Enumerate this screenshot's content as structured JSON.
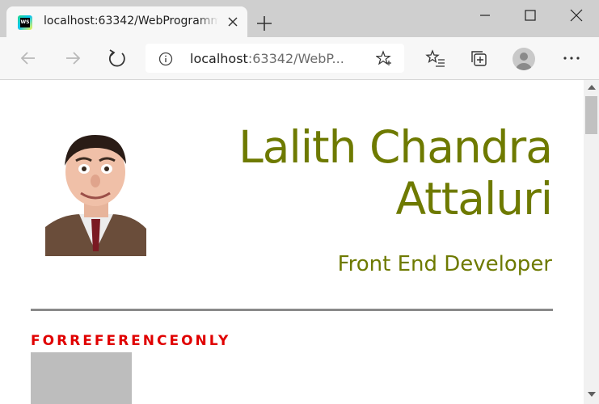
{
  "browser": {
    "tab": {
      "favicon": "webstorm-icon",
      "title": "localhost:63342/WebProgramming"
    },
    "address": {
      "host": "localhost",
      "path": ":63342/WebP...",
      "info_icon": "info-icon"
    },
    "icons": {
      "back": "back-arrow-icon",
      "forward": "forward-arrow-icon",
      "refresh": "refresh-icon",
      "add_favorite": "star-plus-icon",
      "favorites": "favorites-list-icon",
      "collections": "collections-icon",
      "profile": "profile-avatar-icon",
      "more": "more-dots-icon",
      "new_tab": "plus-icon",
      "minimize": "minimize-icon",
      "maximize": "maximize-icon",
      "close": "close-icon"
    }
  },
  "page": {
    "name": "Lalith Chandra Attaluri",
    "role": "Front End Developer",
    "reference_label": "FORREFERENCEONLY"
  },
  "colors": {
    "name": "#6e7a00",
    "reference": "#e00000",
    "rule": "#8a8a8a"
  }
}
